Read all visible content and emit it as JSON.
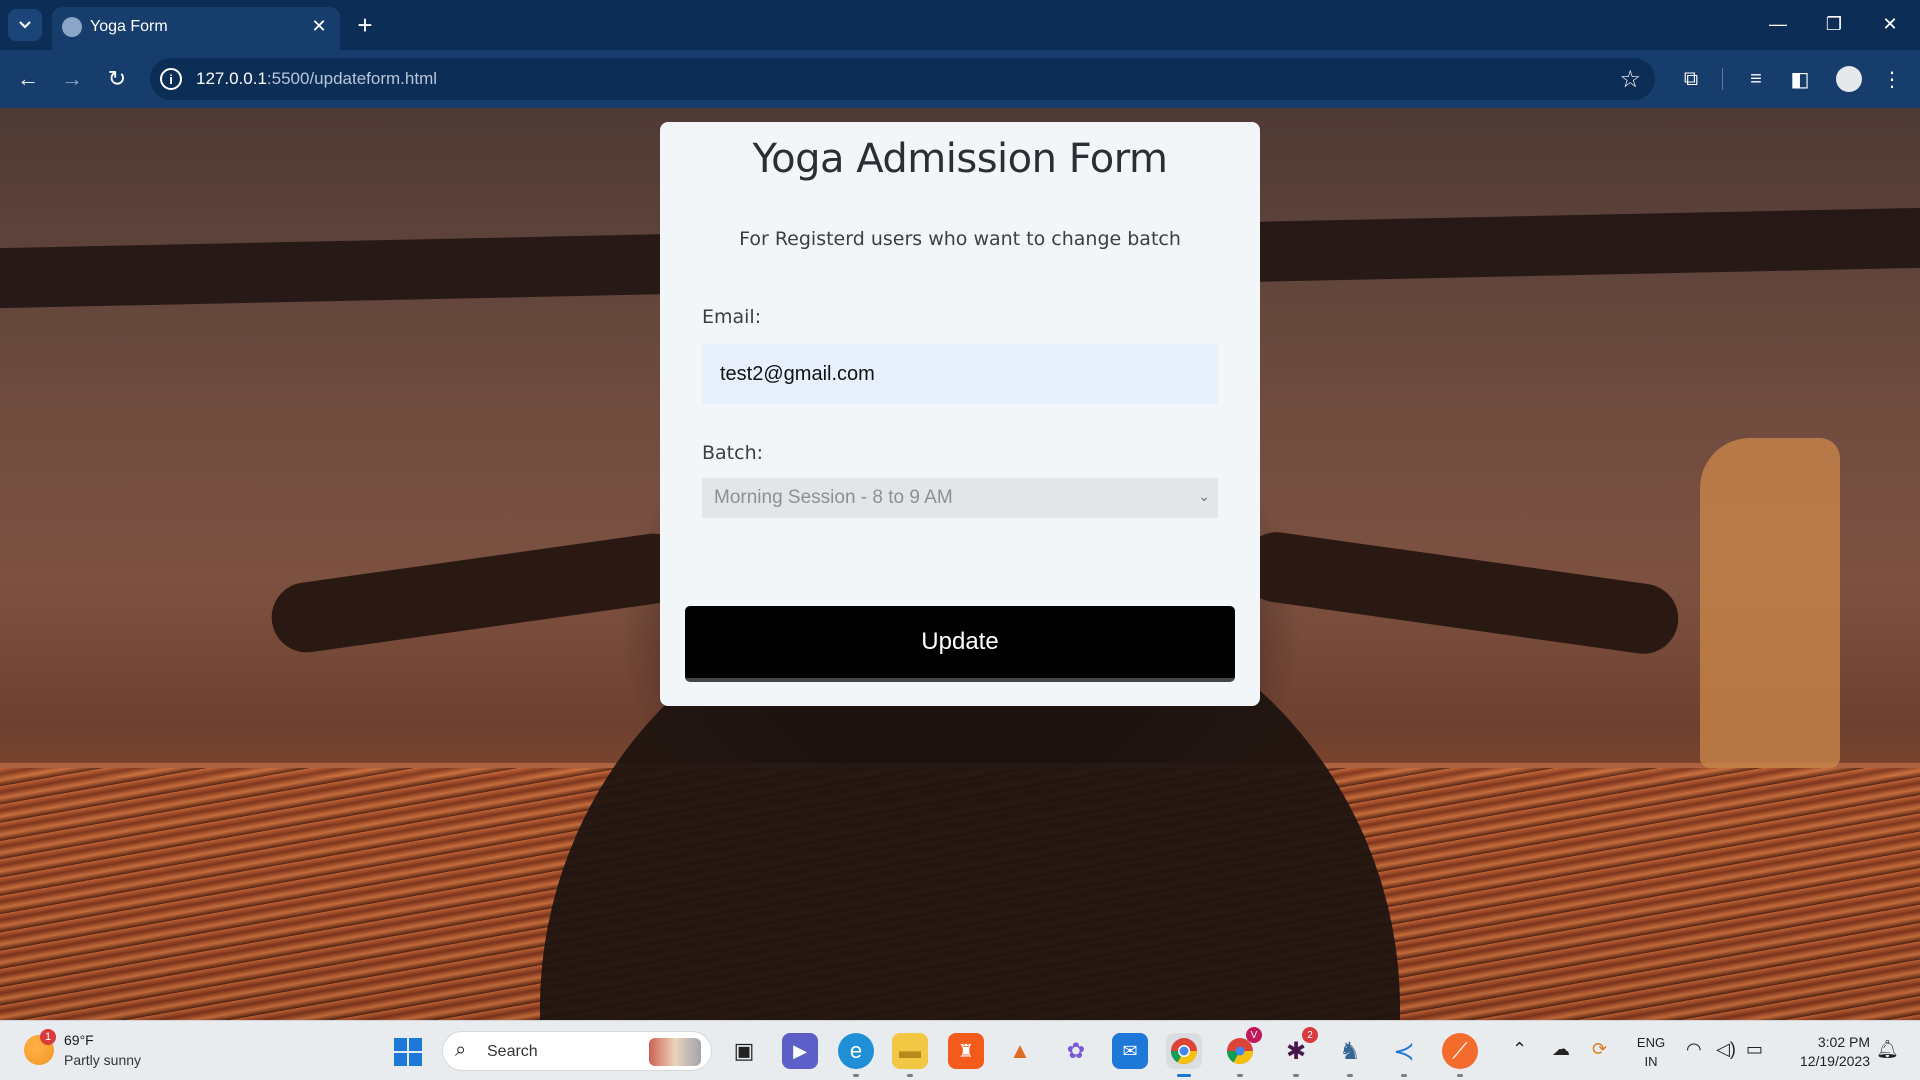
{
  "browser": {
    "tab_title": "Yoga Form",
    "url_host": "127.0.0.1",
    "url_path": ":5500/updateform.html"
  },
  "form": {
    "title": "Yoga Admission Form",
    "subtitle": "For Registerd users who want to change batch",
    "email_label": "Email:",
    "email_value": "test2@gmail.com",
    "batch_label": "Batch:",
    "batch_selected": "Morning Session - 8 to 9 AM",
    "submit_label": "Update"
  },
  "taskbar": {
    "weather_badge": "1",
    "weather_temp": "69°F",
    "weather_desc": "Partly sunny",
    "search_label": "Search",
    "chrome_badge": "V",
    "slack_badge": "2",
    "lang_line1": "ENG",
    "lang_line2": "IN",
    "time": "3:02 PM",
    "date": "12/19/2023"
  },
  "icons": [
    "tab-list-icon",
    "globe-icon",
    "close-icon",
    "plus-icon",
    "minimize-icon",
    "restore-icon",
    "window-close-icon",
    "back-icon",
    "forward-icon",
    "reload-icon",
    "info-icon",
    "star-icon",
    "extensions-icon",
    "media-icon",
    "sidepanel-icon",
    "menu-icon",
    "windows-icon",
    "search-icon",
    "chevron-down-icon"
  ]
}
